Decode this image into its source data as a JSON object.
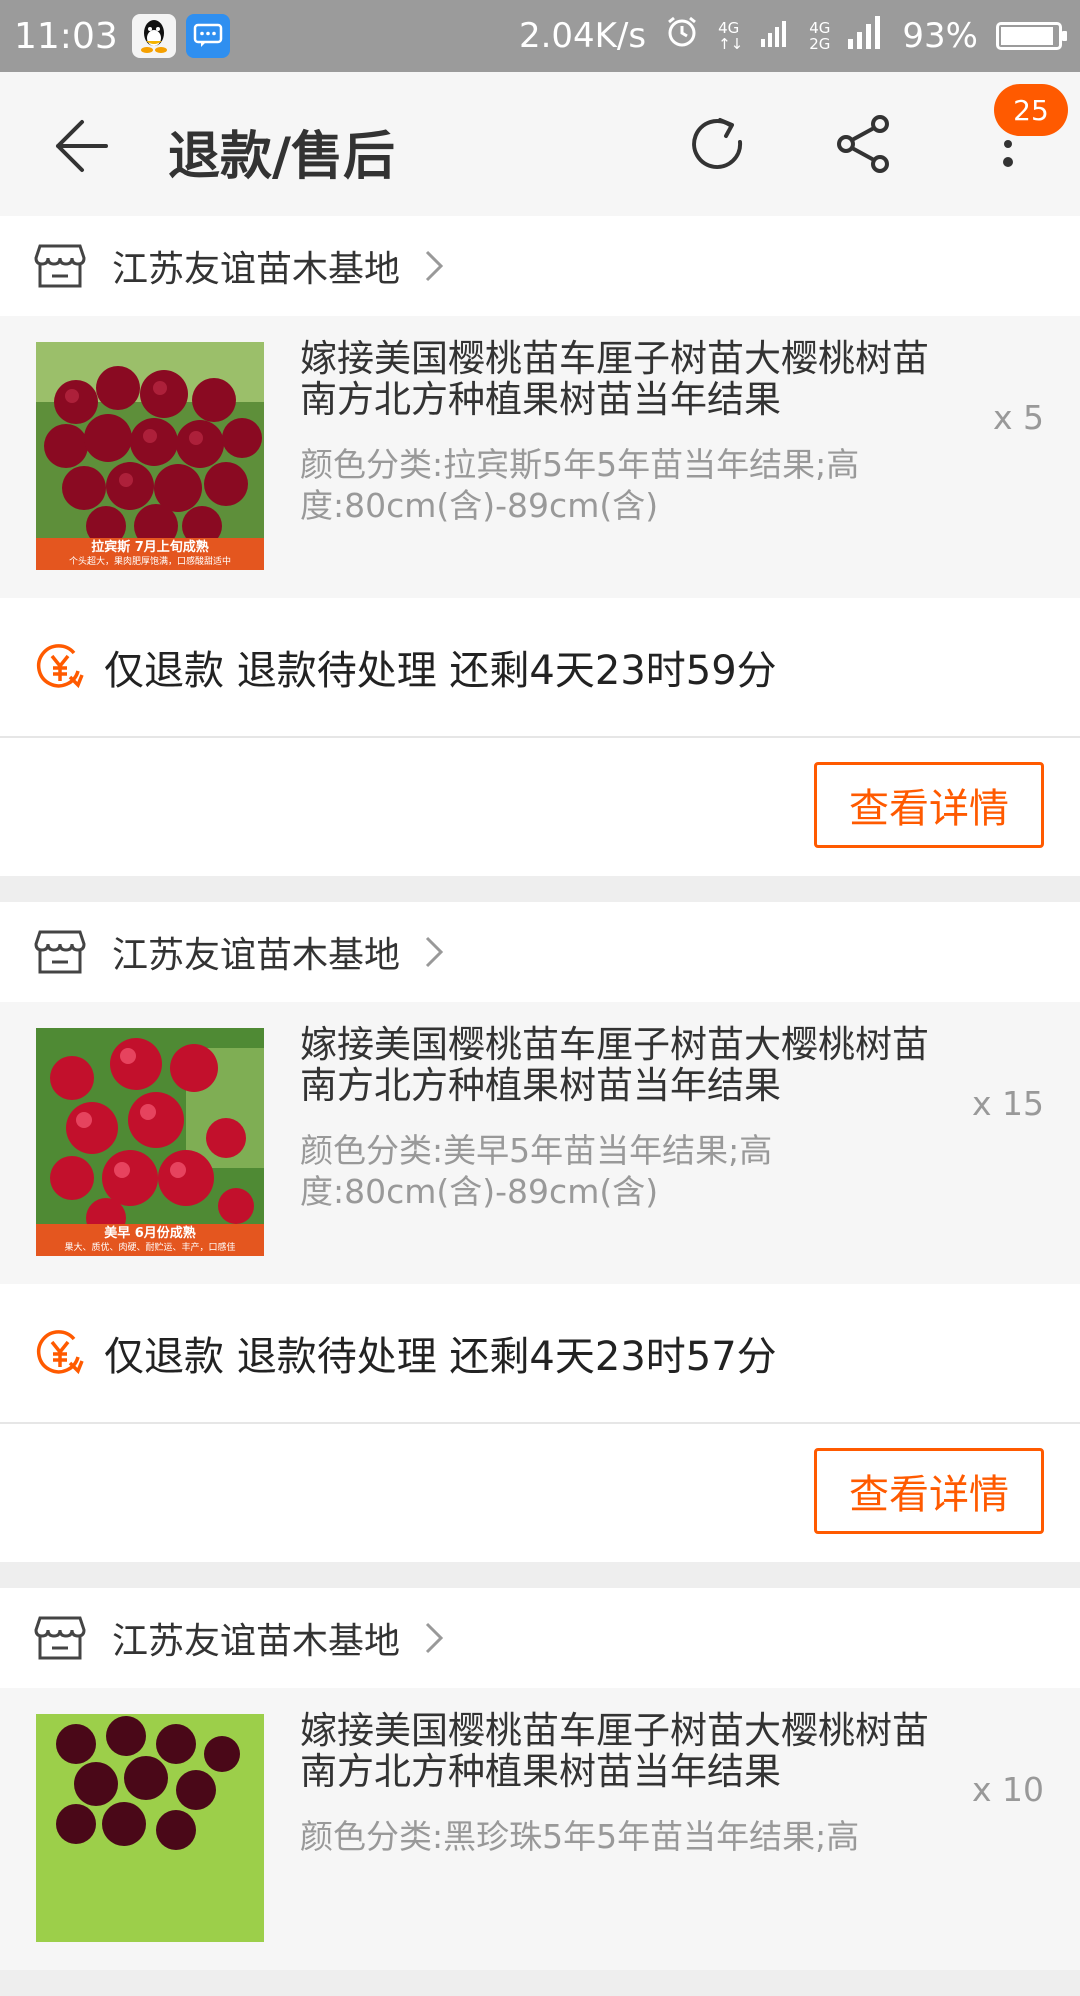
{
  "status_bar": {
    "time": "11:03",
    "net_speed": "2.04K/s",
    "sig1_top": "4G",
    "sig2_top": "4G",
    "sig2_bottom": "2G",
    "battery": "93%",
    "battery_level": 0.93
  },
  "header": {
    "title": "退款/售后",
    "badge_count": "25",
    "icons": [
      "back-arrow-icon",
      "refresh-icon",
      "share-icon",
      "more-icon"
    ]
  },
  "orders": [
    {
      "shop": "江苏友谊苗木基地",
      "product_name": "嫁接美国樱桃苗车厘子树苗大樱桃树苗南方北方种植果树苗当年结果",
      "spec": "颜色分类:拉宾斯5年5年苗当年结果;高度:80cm(含)-89cm(含)",
      "qty": "x 5",
      "thumb_caption": "拉宾斯    7月上旬成熟",
      "thumb_sub": "个头超大，果肉肥厚饱满，口感酸甜适中",
      "status": "仅退款 退款待处理 还剩4天23时59分",
      "button": "查看详情"
    },
    {
      "shop": "江苏友谊苗木基地",
      "product_name": "嫁接美国樱桃苗车厘子树苗大樱桃树苗南方北方种植果树苗当年结果",
      "spec": "颜色分类:美早5年苗当年结果;高度:80cm(含)-89cm(含)",
      "qty": "x 15",
      "thumb_caption": "美早    6月份成熟",
      "thumb_sub": "果大、质优、肉硬、耐贮运、丰产，口感佳",
      "status": "仅退款 退款待处理 还剩4天23时57分",
      "button": "查看详情"
    },
    {
      "shop": "江苏友谊苗木基地",
      "product_name": "嫁接美国樱桃苗车厘子树苗大樱桃树苗南方北方种植果树苗当年结果",
      "spec": "颜色分类:黑珍珠5年5年苗当年结果;高",
      "qty": "x 10"
    }
  ],
  "colors": {
    "accent": "#ff5a00",
    "status_bar": "#9b9b9b"
  }
}
